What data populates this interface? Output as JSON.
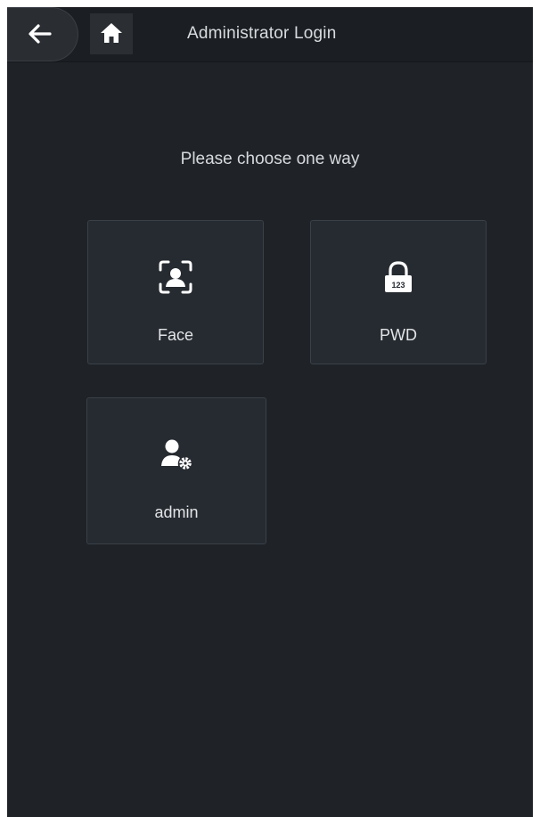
{
  "header": {
    "title": "Administrator Login",
    "back_icon": "arrow-left-icon",
    "home_icon": "home-icon"
  },
  "main": {
    "prompt": "Please choose one way",
    "options": [
      {
        "label": "Face",
        "icon": "face-scan-icon"
      },
      {
        "label": "PWD",
        "icon": "padlock-icon",
        "icon_text": "123"
      },
      {
        "label": "admin",
        "icon": "user-settings-icon"
      }
    ]
  },
  "colors": {
    "background": "#1f2328",
    "header": "#1b1e22",
    "tile": "#262b31",
    "tile_border": "#3a4048",
    "text": "#e2e4e6"
  }
}
